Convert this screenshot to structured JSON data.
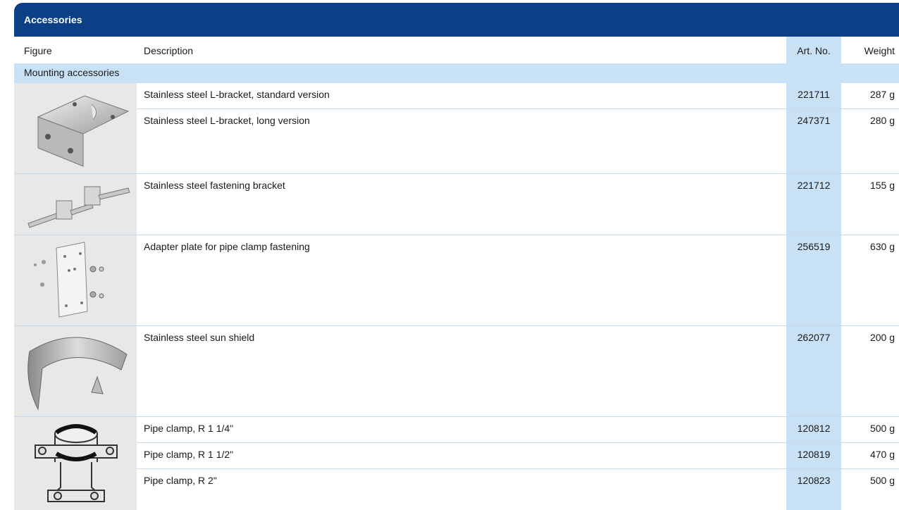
{
  "title": "Accessories",
  "columns": {
    "figure": "Figure",
    "description": "Description",
    "art_no": "Art. No.",
    "weight": "Weight"
  },
  "section": "Mounting accessories",
  "items": [
    {
      "description": "Stainless steel L-bracket, standard version",
      "art_no": "221711",
      "weight": "287 g"
    },
    {
      "description": "Stainless steel L-bracket, long version",
      "art_no": "247371",
      "weight": "280 g"
    },
    {
      "description": "Stainless steel fastening bracket",
      "art_no": "221712",
      "weight": "155 g"
    },
    {
      "description": "Adapter plate for pipe clamp fastening",
      "art_no": "256519",
      "weight": "630 g"
    },
    {
      "description": "Stainless steel sun shield",
      "art_no": "262077",
      "weight": "200 g"
    },
    {
      "description": "Pipe clamp, R 1 1/4\"",
      "art_no": "120812",
      "weight": "500 g"
    },
    {
      "description": "Pipe clamp, R 1 1/2\"",
      "art_no": "120819",
      "weight": "470 g"
    },
    {
      "description": "Pipe clamp, R 2\"",
      "art_no": "120823",
      "weight": "500 g"
    }
  ],
  "figures": [
    "l-bracket-image",
    "fastening-bracket-image",
    "adapter-plate-image",
    "sun-shield-image",
    "pipe-clamp-image"
  ]
}
